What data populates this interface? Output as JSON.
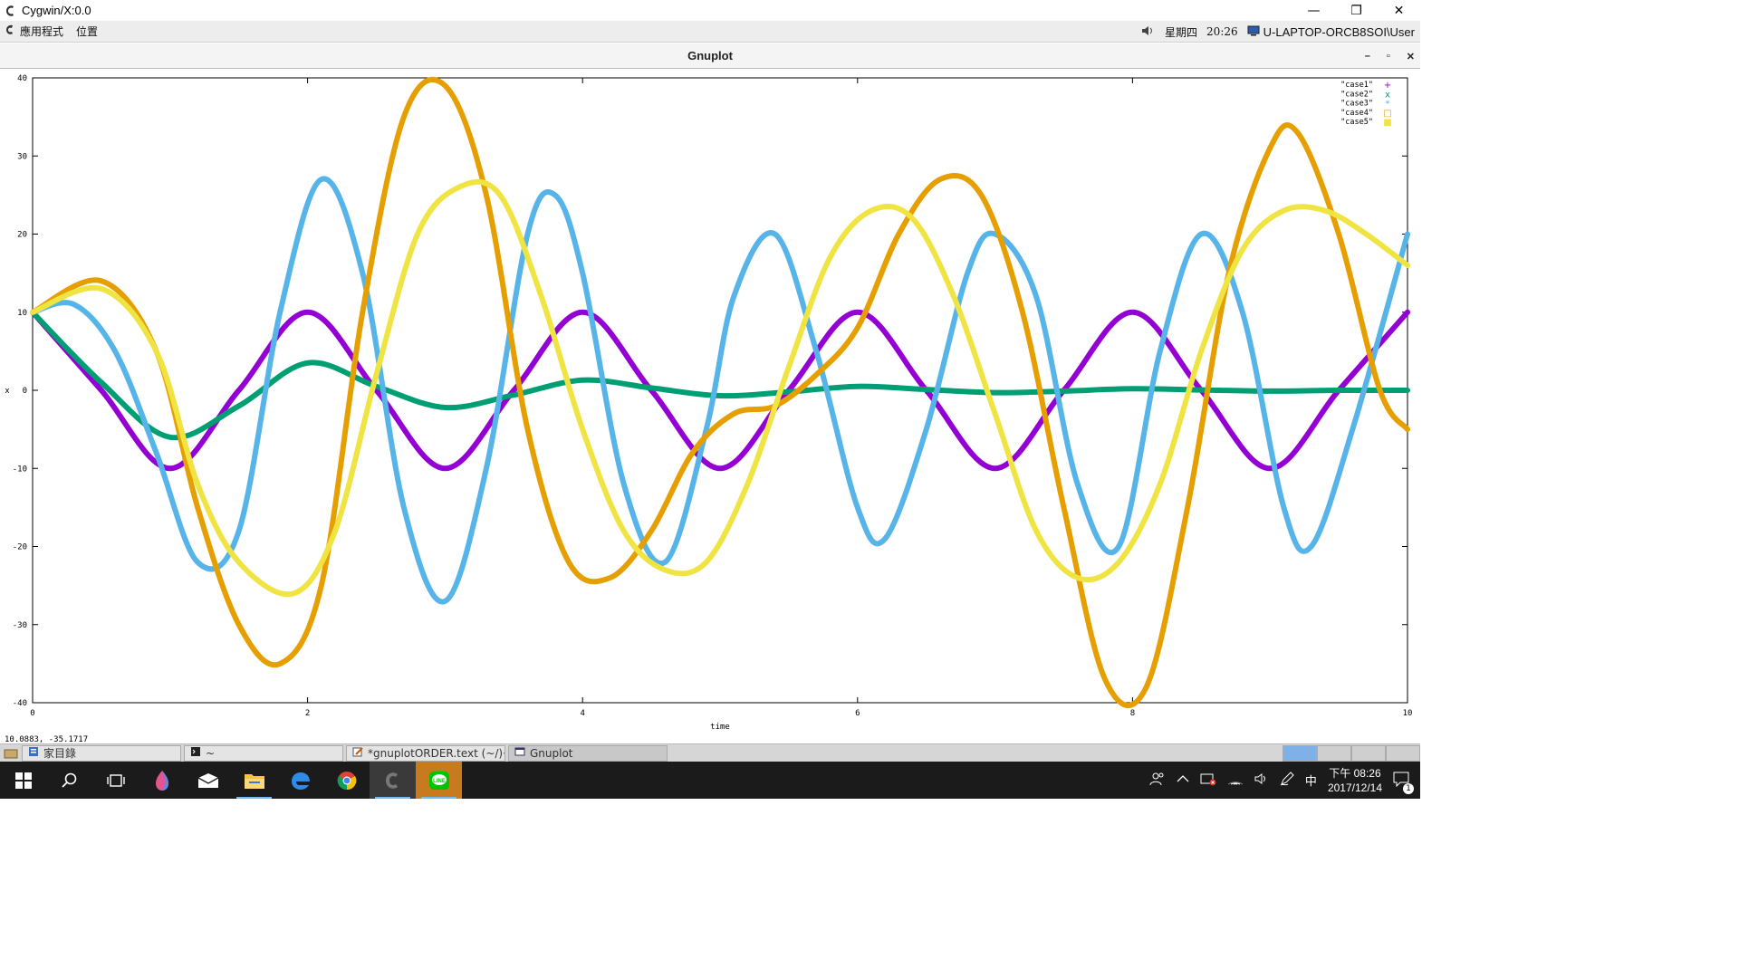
{
  "window": {
    "title": "Cygwin/X:0.0",
    "controls": [
      "—",
      "❐",
      "✕"
    ]
  },
  "panel": {
    "menu_apps": "應用程式",
    "menu_places": "位置",
    "weekday": "星期四",
    "time": "20:26",
    "host": "U-LAPTOP-ORCB8SOI\\User"
  },
  "gnuplot_window": {
    "title": "Gnuplot",
    "controls": [
      "–",
      "▫",
      "✕"
    ]
  },
  "coord_readout": "10.0883, -35.1717",
  "chart_data": {
    "type": "line",
    "title": "",
    "xlabel": "time",
    "ylabel": "x",
    "xlim": [
      0,
      10
    ],
    "ylim": [
      -40,
      40
    ],
    "xticks": [
      "0",
      "2",
      "4",
      "6",
      "8",
      "10"
    ],
    "yticks": [
      "40",
      "30",
      "20",
      "10",
      "0",
      "-10",
      "-20",
      "-30",
      "-40"
    ],
    "legend_position": "top-right",
    "series": [
      {
        "name": "\"case1\"",
        "marker": "+",
        "color": "#9400d3",
        "x": [
          0,
          0.5,
          1.0,
          1.5,
          2.0,
          2.5,
          3.0,
          3.5,
          4.0,
          4.5,
          5.0,
          5.5,
          6.0,
          6.5,
          7.0,
          7.5,
          8.0,
          8.5,
          9.0,
          9.5,
          10.0
        ],
        "y": [
          10,
          0,
          -10,
          0,
          10,
          0,
          -10,
          0,
          10,
          0,
          -10,
          0,
          10,
          0,
          -10,
          0,
          10,
          0,
          -10,
          0,
          10
        ]
      },
      {
        "name": "\"case2\"",
        "marker": "x",
        "color": "#009e73",
        "x": [
          0,
          0.5,
          1.0,
          1.5,
          2.0,
          2.5,
          3.0,
          3.5,
          4.0,
          4.5,
          5.0,
          5.5,
          6.0,
          6.5,
          7.0,
          7.5,
          8.0,
          8.5,
          9.0,
          9.5,
          10.0
        ],
        "y": [
          10,
          1,
          -6,
          -2,
          3.5,
          0.5,
          -2.2,
          -0.6,
          1.3,
          0.3,
          -0.7,
          -0.2,
          0.5,
          0.1,
          -0.3,
          -0.1,
          0.2,
          0.05,
          -0.1,
          0,
          0
        ]
      },
      {
        "name": "\"case3\"",
        "marker": "*",
        "color": "#56b4e9",
        "x": [
          0,
          0.3,
          0.6,
          0.9,
          1.2,
          1.5,
          1.8,
          2.1,
          2.4,
          2.7,
          3.0,
          3.3,
          3.6,
          3.8,
          4.0,
          4.3,
          4.6,
          4.9,
          5.1,
          5.4,
          5.7,
          6.0,
          6.2,
          6.5,
          6.8,
          7.0,
          7.3,
          7.6,
          7.9,
          8.2,
          8.5,
          8.8,
          9.1,
          9.3,
          9.6,
          10.0
        ],
        "y": [
          10,
          11,
          5,
          -8,
          -22,
          -18,
          10,
          27,
          15,
          -15,
          -27,
          -10,
          20,
          25,
          15,
          -12,
          -22,
          -5,
          12,
          20,
          5,
          -15,
          -19,
          -5,
          15,
          20,
          12,
          -12,
          -20,
          5,
          20,
          10,
          -15,
          -20,
          -5,
          20
        ]
      },
      {
        "name": "\"case4\"",
        "marker": "□",
        "color": "#e69f00",
        "x": [
          0,
          0.5,
          0.9,
          1.2,
          1.5,
          1.8,
          2.1,
          2.4,
          2.7,
          3.0,
          3.3,
          3.6,
          3.9,
          4.2,
          4.5,
          4.8,
          5.1,
          5.4,
          5.7,
          6.0,
          6.3,
          6.6,
          6.9,
          7.2,
          7.5,
          7.8,
          8.1,
          8.4,
          8.7,
          9.0,
          9.2,
          9.5,
          9.8,
          10.0
        ],
        "y": [
          10,
          14,
          5,
          -15,
          -30,
          -35,
          -25,
          10,
          35,
          39,
          25,
          -5,
          -22,
          -24,
          -18,
          -8,
          -3,
          -2,
          2,
          8,
          20,
          27,
          25,
          10,
          -15,
          -37,
          -38,
          -15,
          15,
          31,
          33,
          20,
          0,
          -5
        ]
      },
      {
        "name": "\"case5\"",
        "marker": "■",
        "color": "#f0e442",
        "x": [
          0,
          0.5,
          0.9,
          1.2,
          1.5,
          1.9,
          2.2,
          2.5,
          2.8,
          3.1,
          3.4,
          3.7,
          4.0,
          4.3,
          4.6,
          4.9,
          5.2,
          5.5,
          5.8,
          6.1,
          6.4,
          6.7,
          7.0,
          7.3,
          7.6,
          7.9,
          8.2,
          8.5,
          8.8,
          9.1,
          9.4,
          9.7,
          10.0
        ],
        "y": [
          10,
          13,
          5,
          -12,
          -22,
          -26,
          -18,
          2,
          20,
          26,
          25,
          12,
          -5,
          -18,
          -23,
          -22,
          -12,
          3,
          17,
          23,
          22,
          12,
          -3,
          -18,
          -24,
          -22,
          -12,
          5,
          18,
          23,
          23,
          20,
          16
        ]
      }
    ]
  },
  "x_taskbar": {
    "tasks": [
      {
        "label": "家目錄",
        "icon": "file-manager-icon"
      },
      {
        "label": "~",
        "icon": "terminal-icon"
      },
      {
        "label": "*gnuplotORDER.text (~/)···",
        "icon": "text-editor-icon"
      },
      {
        "label": "Gnuplot",
        "icon": "window-icon"
      }
    ]
  },
  "win_taskbar": {
    "input_method": "中",
    "clock_ampm": "下午 08:26",
    "date": "2017/12/14",
    "notification_count": "1"
  }
}
